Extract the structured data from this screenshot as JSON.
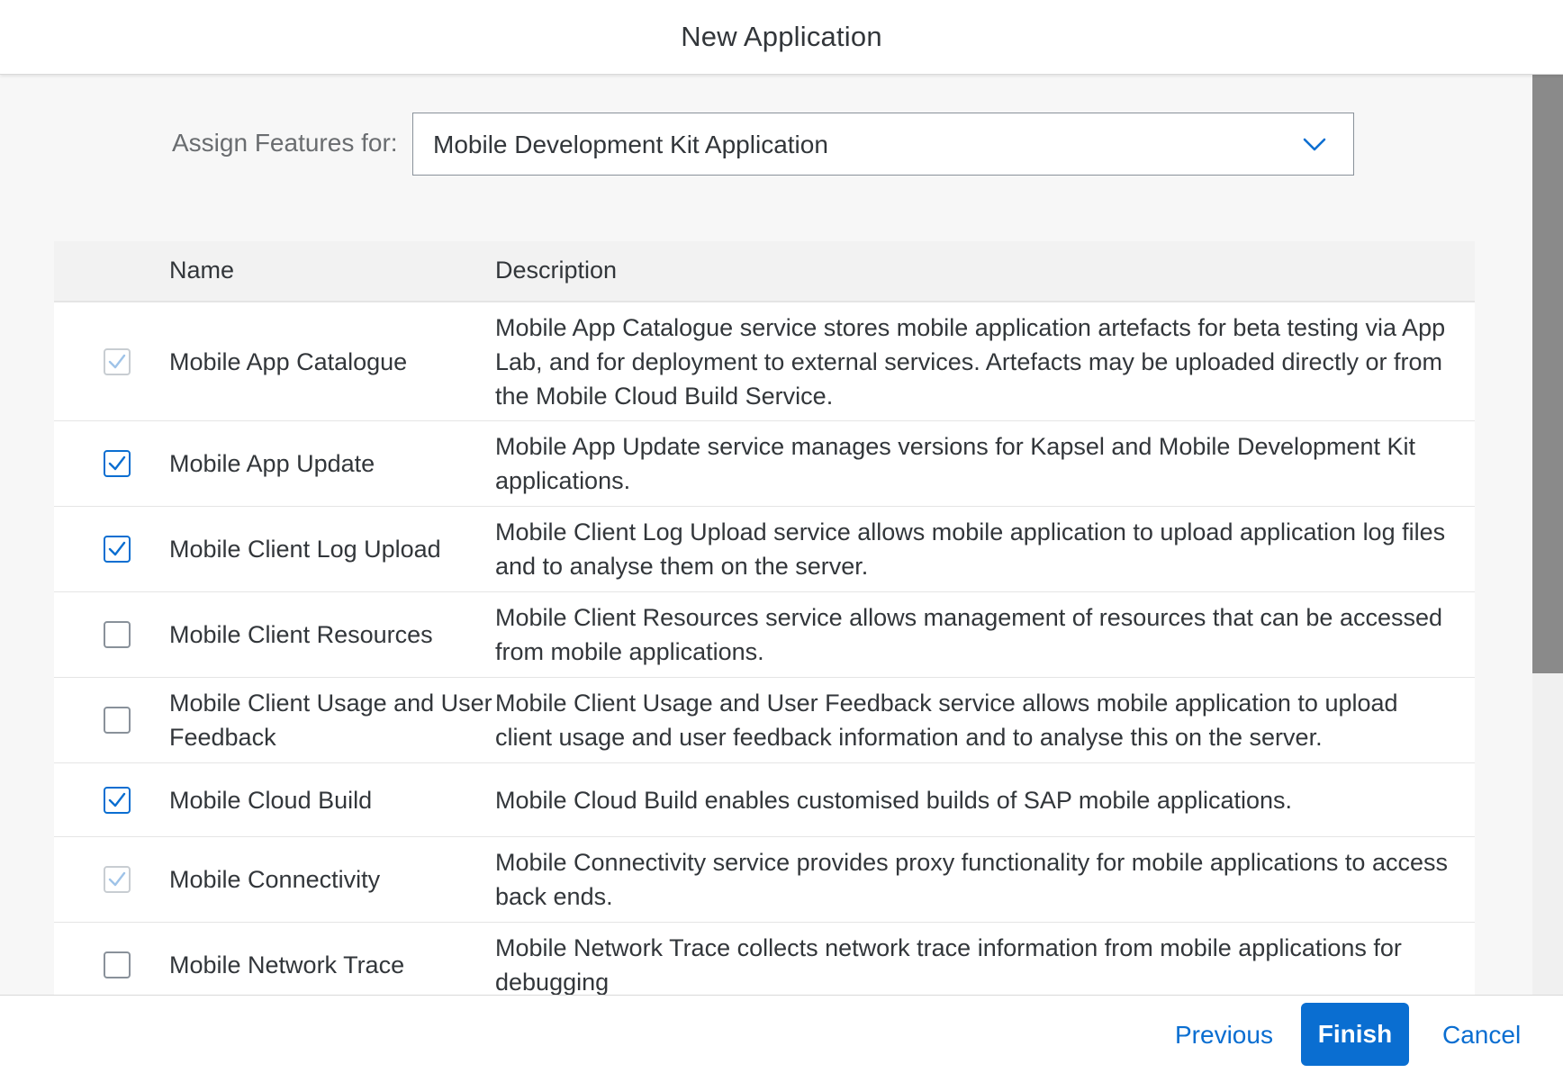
{
  "dialog": {
    "title": "New Application"
  },
  "assign": {
    "label": "Assign Features for:",
    "selected": "Mobile Development Kit Application",
    "chevron_icon": "chevron-down-icon"
  },
  "table": {
    "columns": {
      "name": "Name",
      "description": "Description"
    },
    "rows": [
      {
        "name": "Mobile App Catalogue",
        "description": "Mobile App Catalogue service stores mobile application artefacts for beta testing via App Lab, and for deployment to external services. Artefacts may be uploaded directly or from the Mobile Cloud Build Service.",
        "state": "disabled-checked"
      },
      {
        "name": "Mobile App Update",
        "description": "Mobile App Update service manages versions for Kapsel and Mobile Development Kit applications.",
        "state": "checked"
      },
      {
        "name": "Mobile Client Log Upload",
        "description": "Mobile Client Log Upload service allows mobile application to upload application log files and to analyse them on the server.",
        "state": "checked"
      },
      {
        "name": "Mobile Client Resources",
        "description": "Mobile Client Resources service allows management of resources that can be accessed from mobile applications.",
        "state": "unchecked"
      },
      {
        "name": "Mobile Client Usage and User Feedback",
        "description": "Mobile Client Usage and User Feedback service allows mobile application to upload client usage and user feedback information and to analyse this on the server.",
        "state": "unchecked"
      },
      {
        "name": "Mobile Cloud Build",
        "description": "Mobile Cloud Build enables customised builds of SAP mobile applications.",
        "state": "checked"
      },
      {
        "name": "Mobile Connectivity",
        "description": "Mobile Connectivity service provides proxy functionality for mobile applications to access back ends.",
        "state": "disabled-checked"
      },
      {
        "name": "Mobile Network Trace",
        "description": "Mobile Network Trace collects network trace information from mobile applications for debugging",
        "state": "unchecked"
      }
    ]
  },
  "footer": {
    "previous": "Previous",
    "finish": "Finish",
    "cancel": "Cancel"
  },
  "colors": {
    "accent": "#0a6ed1",
    "background": "#f7f7f7",
    "text": "#32363a",
    "label": "#6a6d70"
  }
}
